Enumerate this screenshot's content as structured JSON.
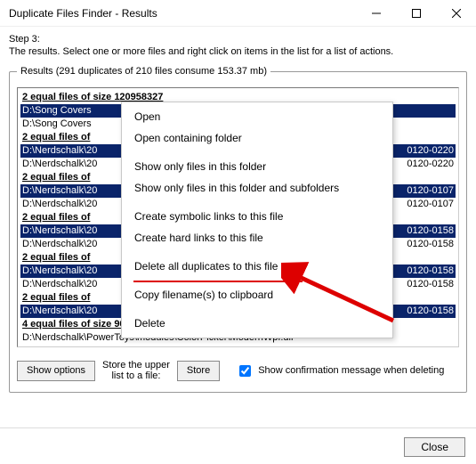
{
  "window": {
    "title": "Duplicate Files Finder - Results"
  },
  "step_label": "Step 3:",
  "instruction": "The results. Select one or more files and right click on items in the list for a list of actions.",
  "results_legend": "Results (291 duplicates of 210 files consume 153.37 mb)",
  "rows": [
    {
      "type": "header",
      "text": "2 equal files of size 120958327"
    },
    {
      "type": "item",
      "sel": true,
      "path": "D:\\Song Covers",
      "date": ""
    },
    {
      "type": "item",
      "sel": false,
      "path": "D:\\Song Covers",
      "date": ""
    },
    {
      "type": "header",
      "text": "2 equal files of"
    },
    {
      "type": "item",
      "sel": true,
      "path": "D:\\Nerdschalk\\20",
      "date": "0120-0220"
    },
    {
      "type": "item",
      "sel": false,
      "path": "D:\\Nerdschalk\\20",
      "date": "0120-0220"
    },
    {
      "type": "header",
      "text": "2 equal files of"
    },
    {
      "type": "item",
      "sel": true,
      "path": "D:\\Nerdschalk\\20",
      "date": "0120-0107"
    },
    {
      "type": "item",
      "sel": false,
      "path": "D:\\Nerdschalk\\20",
      "date": "0120-0107"
    },
    {
      "type": "header",
      "text": "2 equal files of"
    },
    {
      "type": "item",
      "sel": true,
      "path": "D:\\Nerdschalk\\20",
      "date": "0120-0158"
    },
    {
      "type": "item",
      "sel": false,
      "path": "D:\\Nerdschalk\\20",
      "date": "0120-0158"
    },
    {
      "type": "header",
      "text": "2 equal files of"
    },
    {
      "type": "item",
      "sel": true,
      "path": "D:\\Nerdschalk\\20",
      "date": "0120-0158"
    },
    {
      "type": "item",
      "sel": false,
      "path": "D:\\Nerdschalk\\20",
      "date": "0120-0158"
    },
    {
      "type": "header",
      "text": "2 equal files of"
    },
    {
      "type": "item",
      "sel": true,
      "path": "D:\\Nerdschalk\\20",
      "date": "0120-0158"
    },
    {
      "type": "header",
      "text": "4 equal files of size 902144"
    },
    {
      "type": "item",
      "sel": false,
      "path": "D:\\Nerdschalk\\PowerToys\\modules\\ColorPicker\\ModernWpf.dll",
      "date": ""
    }
  ],
  "context_menu": {
    "items": [
      "Open",
      "Open containing folder",
      "",
      "Show only files in this folder",
      "Show only files in this folder and subfolders",
      "",
      "Create symbolic links to this file",
      "Create hard links to this file",
      "",
      "Delete all duplicates to this file",
      "",
      "Copy filename(s) to clipboard",
      "",
      "Delete"
    ]
  },
  "buttons": {
    "show_options": "Show options",
    "store_label": "Store the upper\nlist to a file:",
    "store": "Store",
    "confirm_checkbox": "Show confirmation message when deleting",
    "close": "Close"
  }
}
